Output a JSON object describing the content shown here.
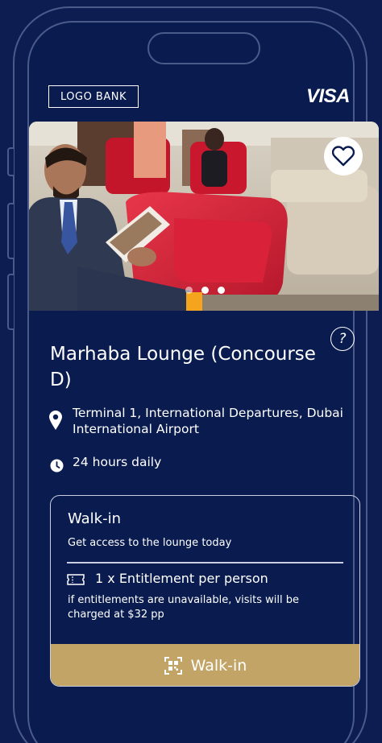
{
  "header": {
    "logo_label": "LOGO BANK",
    "brand": "VISA"
  },
  "hero": {
    "favorite_icon": "heart-outline-icon",
    "carousel_count": 3,
    "carousel_active_index": 1
  },
  "lounge": {
    "help_label": "?",
    "name": "Marhaba Lounge (Concourse D)",
    "location": "Terminal 1, International Departures, Dubai International Airport",
    "hours": "24 hours daily"
  },
  "walkin_card": {
    "title": "Walk-in",
    "subtitle": "Get access to the lounge today",
    "entitlement": "1 x Entitlement per person",
    "note": "if entitlements are unavailable, visits will be charged at $32 pp",
    "button_label": "Walk-in",
    "button_icon": "qr-scan-icon"
  },
  "colors": {
    "background": "#0a1c4f",
    "accent_gold": "#c1a466",
    "text": "#ffffff"
  }
}
